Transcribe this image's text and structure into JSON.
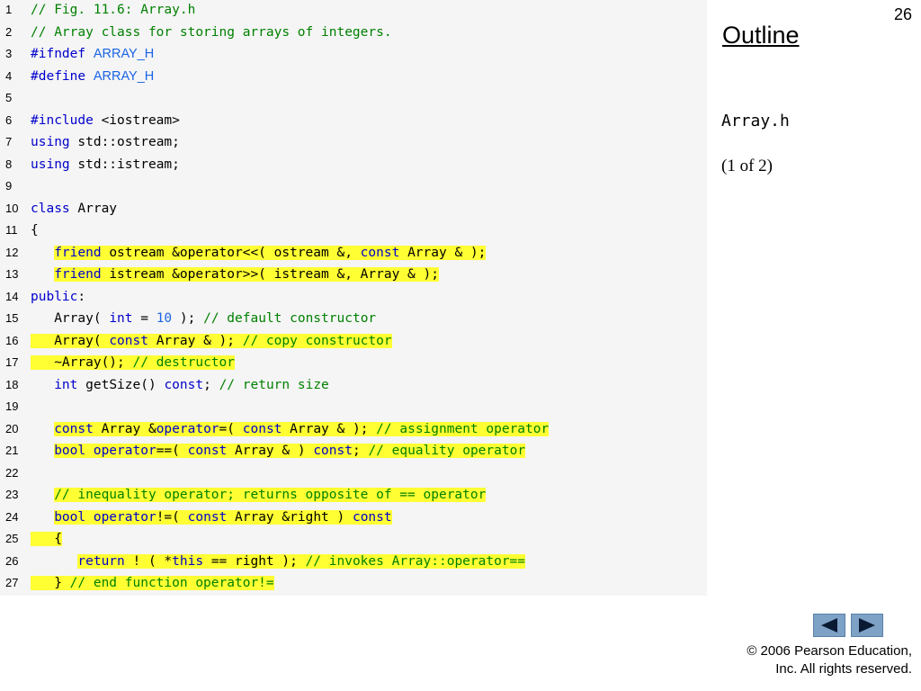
{
  "page_number": "26",
  "sidebar": {
    "outline_label": "Outline",
    "file_name": "Array.h",
    "part_label": "(1 of 2)"
  },
  "navigation": {
    "prev_icon": "triangle-left-icon",
    "next_icon": "triangle-right-icon"
  },
  "copyright": {
    "line1": "© 2006 Pearson Education,",
    "line2": "Inc.  All rights reserved."
  },
  "colors": {
    "keyword": "#0000cc",
    "comment": "#008000",
    "macro": "#1a64e6",
    "highlight": "#ffff33",
    "nav_button": "#7ea2c6"
  },
  "code_lines": [
    {
      "n": "1",
      "hl": false,
      "tokens": [
        [
          "comment",
          "// Fig. 11.6: Array.h"
        ]
      ]
    },
    {
      "n": "2",
      "hl": false,
      "tokens": [
        [
          "comment",
          "// Array class for storing arrays of integers."
        ]
      ]
    },
    {
      "n": "3",
      "hl": false,
      "tokens": [
        [
          "keyword",
          "#ifndef "
        ],
        [
          "macro",
          "ARRAY_H"
        ]
      ]
    },
    {
      "n": "4",
      "hl": false,
      "tokens": [
        [
          "keyword",
          "#define "
        ],
        [
          "macro",
          "ARRAY_H"
        ]
      ]
    },
    {
      "n": "5",
      "hl": false,
      "tokens": []
    },
    {
      "n": "6",
      "hl": false,
      "tokens": [
        [
          "keyword",
          "#include "
        ],
        [
          "plain",
          "<iostream>"
        ]
      ]
    },
    {
      "n": "7",
      "hl": false,
      "tokens": [
        [
          "keyword",
          "using "
        ],
        [
          "plain",
          "std::ostream;"
        ]
      ]
    },
    {
      "n": "8",
      "hl": false,
      "tokens": [
        [
          "keyword",
          "using "
        ],
        [
          "plain",
          "std::istream;"
        ]
      ]
    },
    {
      "n": "9",
      "hl": false,
      "tokens": []
    },
    {
      "n": "10",
      "hl": false,
      "tokens": [
        [
          "keyword",
          "class "
        ],
        [
          "plain",
          "Array"
        ]
      ]
    },
    {
      "n": "11",
      "hl": false,
      "tokens": [
        [
          "plain",
          "{"
        ]
      ]
    },
    {
      "n": "12",
      "hl": true,
      "tokens": [
        [
          "plain",
          "   "
        ],
        [
          "keyword",
          "friend "
        ],
        [
          "plain",
          "ostream &operator<<( ostream &, "
        ],
        [
          "keyword",
          "const "
        ],
        [
          "plain",
          "Array & );"
        ]
      ]
    },
    {
      "n": "13",
      "hl": true,
      "tokens": [
        [
          "plain",
          "   "
        ],
        [
          "keyword",
          "friend "
        ],
        [
          "plain",
          "istream &operator>>( istream &, Array & );"
        ]
      ]
    },
    {
      "n": "14",
      "hl": false,
      "tokens": [
        [
          "keyword",
          "public"
        ],
        [
          "plain",
          ":"
        ]
      ]
    },
    {
      "n": "15",
      "hl": false,
      "tokens": [
        [
          "plain",
          "   Array( "
        ],
        [
          "keyword",
          "int "
        ],
        [
          "plain",
          "= "
        ],
        [
          "number",
          "10"
        ],
        [
          "plain",
          " ); "
        ],
        [
          "comment",
          "// default constructor"
        ]
      ]
    },
    {
      "n": "16",
      "hl": true,
      "tokens": [
        [
          "plain",
          "   Array( "
        ],
        [
          "keyword",
          "const "
        ],
        [
          "plain",
          "Array & ); "
        ],
        [
          "comment",
          "// copy constructor"
        ]
      ]
    },
    {
      "n": "17",
      "hl": true,
      "tokens": [
        [
          "plain",
          "   ~Array(); "
        ],
        [
          "comment",
          "// destructor"
        ]
      ]
    },
    {
      "n": "18",
      "hl": false,
      "tokens": [
        [
          "plain",
          "   "
        ],
        [
          "keyword",
          "int "
        ],
        [
          "plain",
          "getSize() "
        ],
        [
          "keyword",
          "const"
        ],
        [
          "plain",
          "; "
        ],
        [
          "comment",
          "// return size"
        ]
      ]
    },
    {
      "n": "19",
      "hl": false,
      "tokens": []
    },
    {
      "n": "20",
      "hl": true,
      "tokens": [
        [
          "plain",
          "   "
        ],
        [
          "keyword",
          "const "
        ],
        [
          "plain",
          "Array &"
        ],
        [
          "keyword",
          "operator"
        ],
        [
          "plain",
          "=( "
        ],
        [
          "keyword",
          "const "
        ],
        [
          "plain",
          "Array & ); "
        ],
        [
          "comment",
          "// assignment operator"
        ]
      ]
    },
    {
      "n": "21",
      "hl": true,
      "tokens": [
        [
          "plain",
          "   "
        ],
        [
          "keyword",
          "bool operator"
        ],
        [
          "plain",
          "==( "
        ],
        [
          "keyword",
          "const "
        ],
        [
          "plain",
          "Array & ) "
        ],
        [
          "keyword",
          "const"
        ],
        [
          "plain",
          "; "
        ],
        [
          "comment",
          "// equality operator"
        ]
      ]
    },
    {
      "n": "22",
      "hl": false,
      "tokens": []
    },
    {
      "n": "23",
      "hl": true,
      "tokens": [
        [
          "plain",
          "   "
        ],
        [
          "comment",
          "// inequality operator; returns opposite of == operator"
        ]
      ]
    },
    {
      "n": "24",
      "hl": true,
      "tokens": [
        [
          "plain",
          "   "
        ],
        [
          "keyword",
          "bool operator"
        ],
        [
          "plain",
          "!=( "
        ],
        [
          "keyword",
          "const "
        ],
        [
          "plain",
          "Array &right ) "
        ],
        [
          "keyword",
          "const"
        ]
      ]
    },
    {
      "n": "25",
      "hl": true,
      "tokens": [
        [
          "plain",
          "   {"
        ]
      ]
    },
    {
      "n": "26",
      "hl": true,
      "tokens": [
        [
          "plain",
          "      "
        ],
        [
          "keyword",
          "return "
        ],
        [
          "plain",
          "! ( *"
        ],
        [
          "keyword",
          "this "
        ],
        [
          "plain",
          "== right ); "
        ],
        [
          "comment",
          "// invokes Array::operator=="
        ]
      ]
    },
    {
      "n": "27",
      "hl": true,
      "tokens": [
        [
          "plain",
          "   } "
        ],
        [
          "comment",
          "// end function operator!="
        ]
      ]
    }
  ]
}
